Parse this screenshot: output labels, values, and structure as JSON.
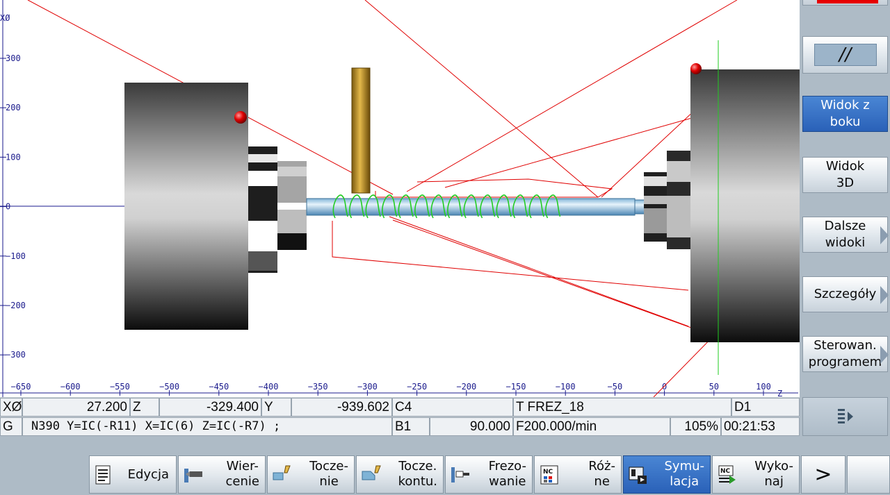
{
  "axes": {
    "x_label": "Z",
    "y_label": "XØ",
    "x_ticks": [
      "−650",
      "−600",
      "−550",
      "−500",
      "−450",
      "−400",
      "−350",
      "−300",
      "−250",
      "−200",
      "−150",
      "−100",
      "−50",
      "0",
      "50",
      "100"
    ],
    "y_ticks": [
      "300",
      "200",
      "100",
      "0",
      "−100",
      "−200",
      "−300"
    ]
  },
  "side_keys": {
    "view_side": "Widok z\nboku",
    "view_3d": "Widok\n3D",
    "more_views": "Dalsze\nwidoki",
    "details": "Szczegóły",
    "program_control": "Sterowan.\nprogramem"
  },
  "status": {
    "x_label": "XØ",
    "x_value": "27.200",
    "z_label": "Z",
    "z_value": "-329.400",
    "y_label": "Y",
    "y_value": "-939.602",
    "c_label": "C4",
    "tool": "T FREZ_18",
    "d_label": "D1",
    "g_label": "G",
    "block": "N390 Y=IC(-R11) X=IC(6) Z=IC(-R7) ;",
    "b_label": "B1",
    "b_value": "90.000",
    "feed": "F200.000/min",
    "override": "105%",
    "time": "00:21:53"
  },
  "bottom_keys": {
    "edit": "Edycja",
    "drilling": "Wier-\ncenie",
    "turning": "Tocze-\nnie",
    "contour_turning": "Tocze.\nkontu.",
    "milling": "Frezo-\nwanie",
    "various": "Róż-\nne",
    "simulation": "Symu-\nlacja",
    "execute": "Wyko-\nnaj",
    "more": ">"
  },
  "colors": {
    "active_key": "#3570c4",
    "path_red": "#e00000",
    "thread_green": "#22cc22",
    "axis_blue": "#1a1a8c"
  }
}
